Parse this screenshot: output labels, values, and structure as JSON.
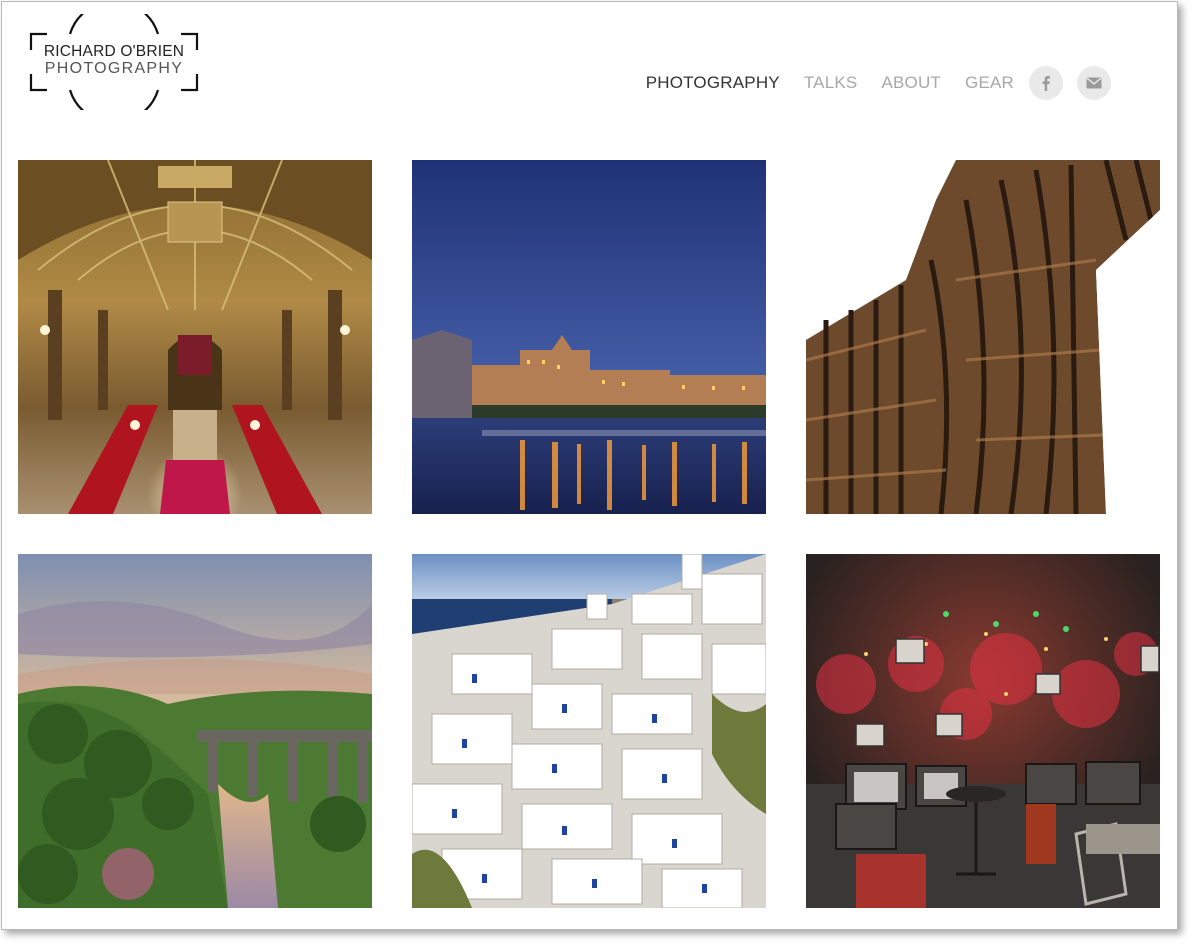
{
  "site": {
    "logo_line1": "RICHARD O'BRIEN",
    "logo_line2": "PHOTOGRAPHY"
  },
  "nav": {
    "items": [
      {
        "label": "PHOTOGRAPHY",
        "active": true
      },
      {
        "label": "TALKS",
        "active": false
      },
      {
        "label": "ABOUT",
        "active": false
      },
      {
        "label": "GEAR",
        "active": false
      }
    ],
    "social": [
      {
        "icon": "facebook-icon"
      },
      {
        "icon": "email-icon"
      }
    ]
  },
  "gallery": {
    "photos": [
      {
        "subject": "ornate-staircase-hall"
      },
      {
        "subject": "city-river-at-dusk"
      },
      {
        "subject": "steel-sculpture-detail"
      },
      {
        "subject": "sunset-viaduct-gorge"
      },
      {
        "subject": "white-hillside-village"
      },
      {
        "subject": "neon-ruin-bar"
      }
    ]
  },
  "colors": {
    "nav_active": "#333333",
    "nav_inactive": "#a8a8a8",
    "social_bg": "#e9e9e9"
  }
}
